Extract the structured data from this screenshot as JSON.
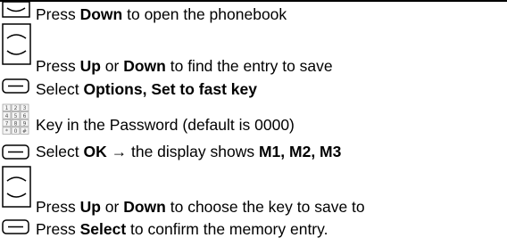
{
  "steps": [
    {
      "icon": "down-key-icon",
      "parts": [
        {
          "t": "Press "
        },
        {
          "t": "Down",
          "b": true
        },
        {
          "t": " to open the phonebook"
        }
      ]
    },
    {
      "icon": "up-down-keys-icon",
      "parts": [
        {
          "t": "Press "
        },
        {
          "t": "Up",
          "b": true
        },
        {
          "t": " or "
        },
        {
          "t": "Down",
          "b": true
        },
        {
          "t": " to find the entry to save"
        }
      ]
    },
    {
      "icon": "softkey-icon",
      "parts": [
        {
          "t": "Select "
        },
        {
          "t": "Options, Set to fast key",
          "b": true
        }
      ]
    },
    {
      "icon": "keypad-icon",
      "parts": [
        {
          "t": "Key in the Password (default is 0000)"
        }
      ]
    },
    {
      "icon": "softkey-icon",
      "parts": [
        {
          "t": "Select "
        },
        {
          "t": "OK",
          "b": true
        },
        {
          "t": " → the display shows "
        },
        {
          "t": "M1, M2, M3",
          "b": true
        }
      ]
    },
    {
      "icon": "up-down-keys-icon",
      "parts": [
        {
          "t": "Press "
        },
        {
          "t": "Up",
          "b": true
        },
        {
          "t": " or "
        },
        {
          "t": "Down",
          "b": true
        },
        {
          "t": " to choose the key to save to"
        }
      ]
    },
    {
      "icon": "softkey-icon",
      "parts": [
        {
          "t": "Press "
        },
        {
          "t": "Select",
          "b": true
        },
        {
          "t": " to confirm the memory entry."
        }
      ]
    }
  ],
  "keypad_labels": [
    "1",
    "2",
    "3",
    "4",
    "5",
    "6",
    "7",
    "8",
    "9",
    "*",
    "0",
    "#"
  ]
}
